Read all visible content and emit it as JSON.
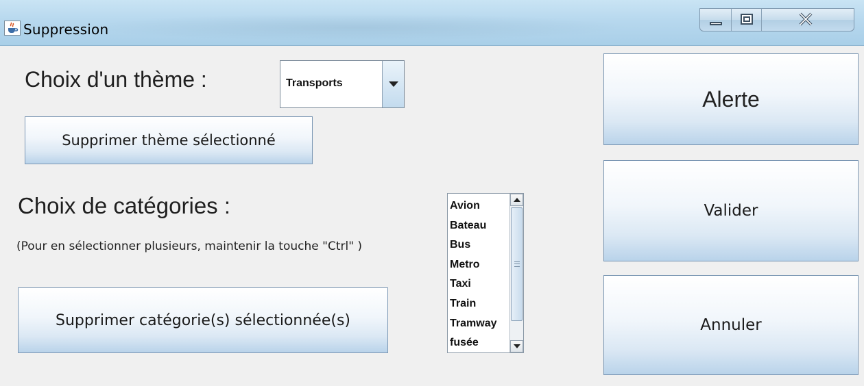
{
  "window": {
    "title": "Suppression",
    "icon": "java-coffee-icon",
    "controls": [
      "minimize-icon",
      "maximize-icon",
      "close-icon"
    ]
  },
  "theme": {
    "label": "Choix d'un thème :",
    "selected": "Transports",
    "delete_button": "Supprimer thème sélectionné"
  },
  "categories": {
    "label": "Choix de catégories :",
    "hint": "(Pour en sélectionner plusieurs, maintenir la touche \"Ctrl\" )",
    "items": [
      "Avion",
      "Bateau",
      "Bus",
      "Metro",
      "Taxi",
      "Train",
      "Tramway",
      "fusée"
    ],
    "delete_button": "Supprimer catégorie(s) sélectionnée(s)"
  },
  "actions": {
    "alert": "Alerte",
    "validate": "Valider",
    "cancel": "Annuler"
  }
}
